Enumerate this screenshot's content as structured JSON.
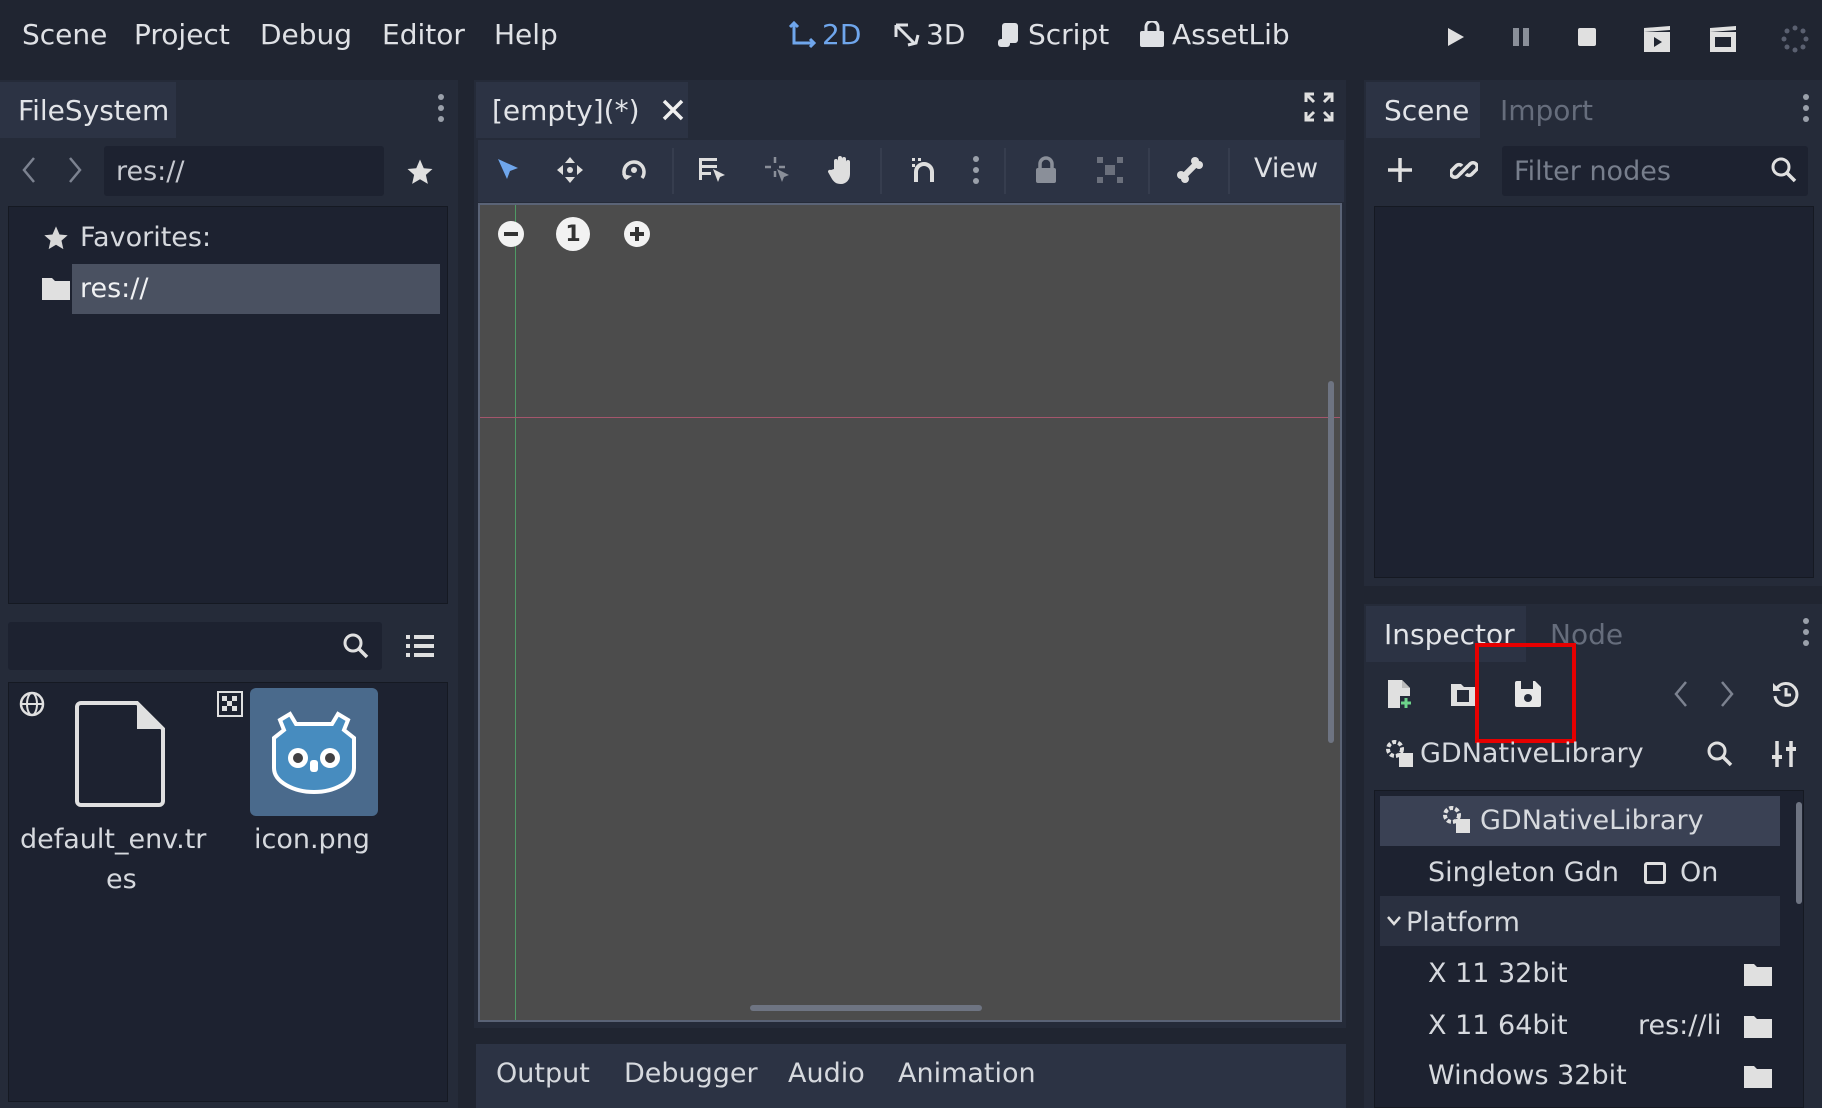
{
  "menu": [
    "Scene",
    "Project",
    "Debug",
    "Editor",
    "Help"
  ],
  "modes": {
    "2d": "2D",
    "3d": "3D",
    "script": "Script",
    "assetlib": "AssetLib"
  },
  "filesystem": {
    "tab": "FileSystem",
    "path": "res://",
    "favorites_label": "Favorites:",
    "root_item": "res://",
    "files": [
      {
        "name": "default_env.tres",
        "line1": "default_env.tr",
        "line2": "es"
      },
      {
        "name": "icon.png",
        "line1": "icon.png",
        "line2": ""
      }
    ]
  },
  "editor": {
    "tab_label": "[empty](*)",
    "view_label": "View",
    "zoom_reset": "1"
  },
  "bottom_tabs": [
    "Output",
    "Debugger",
    "Audio",
    "Animation"
  ],
  "scene_dock": {
    "tabs": [
      "Scene",
      "Import"
    ],
    "filter_placeholder": "Filter nodes"
  },
  "inspector": {
    "tabs": [
      "Inspector",
      "Node"
    ],
    "resource_type": "GDNativeLibrary",
    "section_title": "GDNativeLibrary",
    "singleton_label": "Singleton Gdn",
    "singleton_value": "On",
    "platform_label": "Platform",
    "rows": [
      {
        "label": "X 11 32bit",
        "value": ""
      },
      {
        "label": "X 11 64bit",
        "value": "res://li"
      },
      {
        "label": "Windows 32bit",
        "value": ""
      }
    ]
  },
  "colors": {
    "accent": "#6fa6ec",
    "highlight": "#e60000",
    "bg": "#202531"
  }
}
